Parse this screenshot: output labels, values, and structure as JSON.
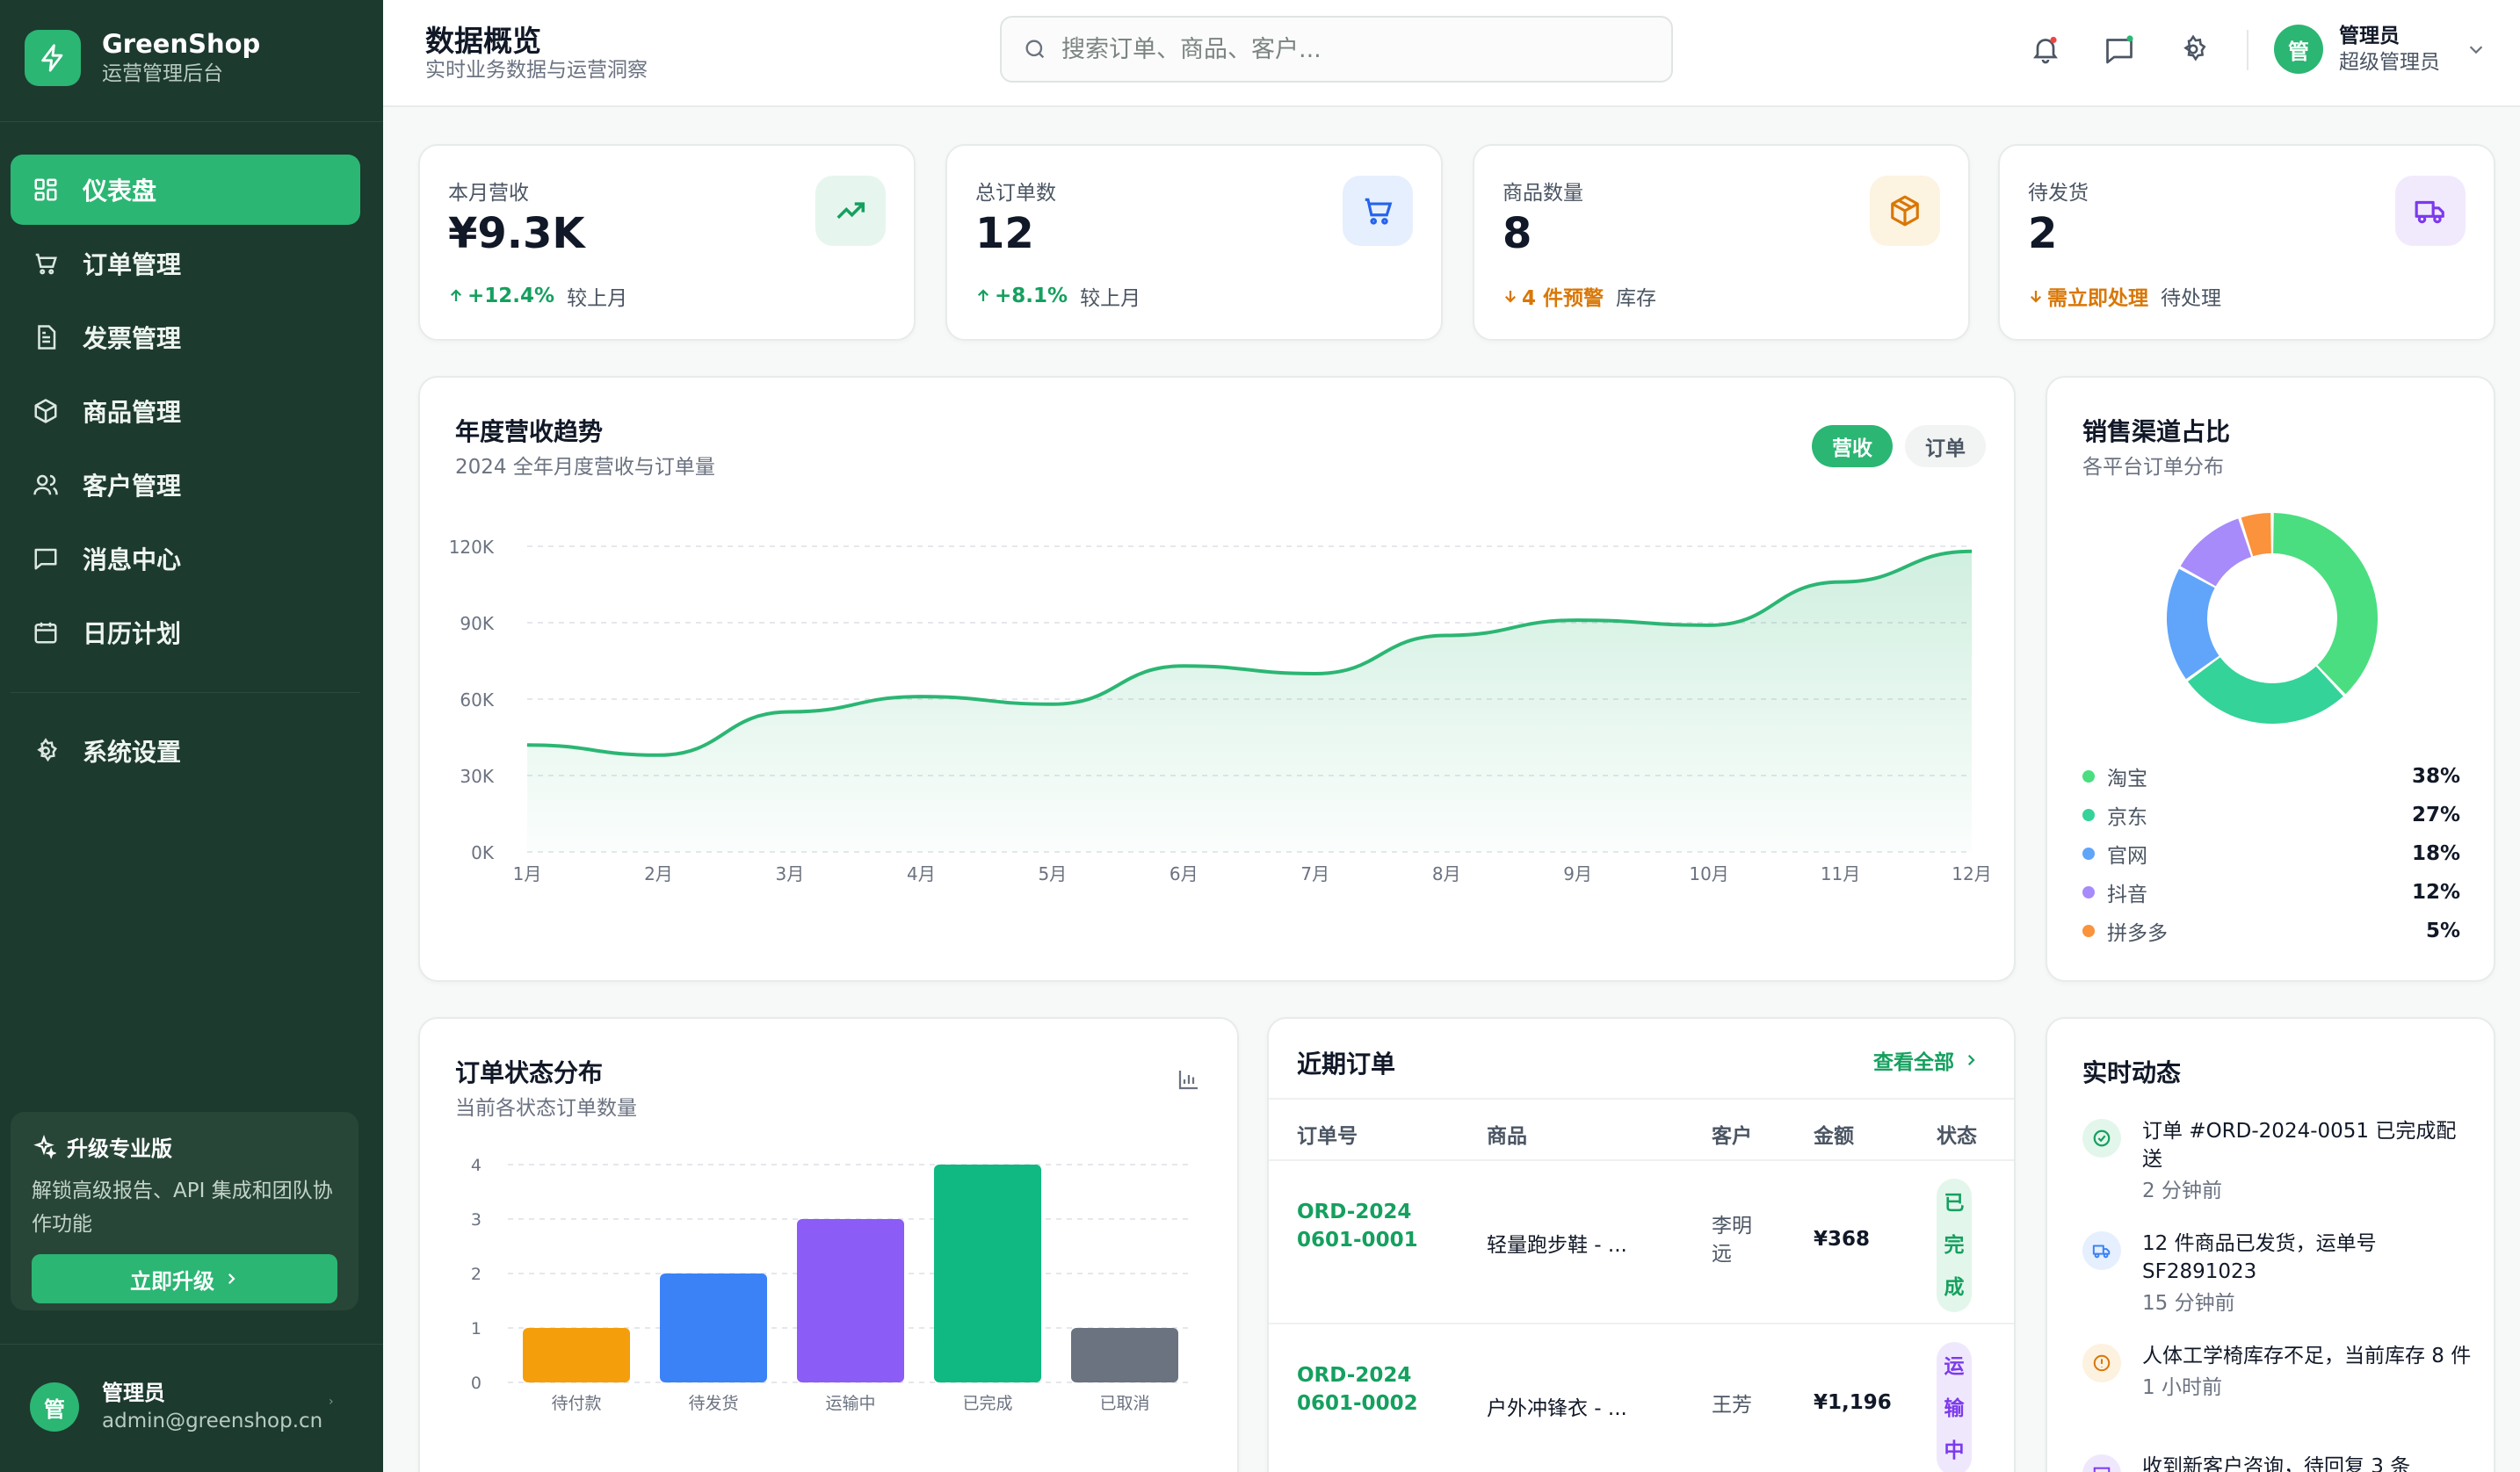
{
  "brand": {
    "name": "GreenShop",
    "subtitle": "运营管理后台"
  },
  "nav": {
    "items": [
      {
        "label": "仪表盘",
        "icon": "dashboard-icon",
        "active": true
      },
      {
        "label": "订单管理",
        "icon": "cart-icon"
      },
      {
        "label": "发票管理",
        "icon": "invoice-icon"
      },
      {
        "label": "商品管理",
        "icon": "box-icon"
      },
      {
        "label": "客户管理",
        "icon": "users-icon"
      },
      {
        "label": "消息中心",
        "icon": "message-icon"
      },
      {
        "label": "日历计划",
        "icon": "calendar-icon"
      }
    ],
    "settings_label": "系统设置"
  },
  "upgrade": {
    "title": "升级专业版",
    "desc": "解锁高级报告、API 集成和团队协作功能",
    "button": "立即升级"
  },
  "side_user": {
    "avatar": "管",
    "name": "管理员",
    "email": "admin@greenshop.cn"
  },
  "header": {
    "title": "数据概览",
    "subtitle": "实时业务数据与运营洞察",
    "search_placeholder": "搜索订单、商品、客户...",
    "user": {
      "avatar": "管",
      "name": "管理员",
      "role": "超级管理员"
    }
  },
  "stats": [
    {
      "label": "本月营收",
      "value": "¥9.3K",
      "trend": "+12.4%",
      "note": "较上月",
      "trend_color": "#15a05f",
      "dir": "up",
      "icon": "trending-up-icon"
    },
    {
      "label": "总订单数",
      "value": "12",
      "trend": "+8.1%",
      "note": "较上月",
      "trend_color": "#15a05f",
      "dir": "up",
      "icon": "cart-icon"
    },
    {
      "label": "商品数量",
      "value": "8",
      "trend": "4 件预警",
      "note": "库存",
      "trend_color": "#d97706",
      "dir": "down",
      "icon": "package-icon"
    },
    {
      "label": "待发货",
      "value": "2",
      "trend": "需立即处理",
      "note": "待处理",
      "trend_color": "#d97706",
      "dir": "down",
      "icon": "truck-icon"
    }
  ],
  "revenue": {
    "title": "年度营收趋势",
    "subtitle": "2024 全年月度营收与订单量",
    "toggle_revenue": "营收",
    "toggle_orders": "订单"
  },
  "channel": {
    "title": "销售渠道占比",
    "subtitle": "各平台订单分布"
  },
  "status_chart": {
    "title": "订单状态分布",
    "subtitle": "当前各状态订单数量"
  },
  "recent": {
    "title": "近期订单",
    "view_all": "查看全部",
    "headers": {
      "order": "订单号",
      "product": "商品",
      "customer": "客户",
      "amount": "金额",
      "status": "状态"
    },
    "rows": [
      {
        "order": "ORD-20240601-0001",
        "product": "轻量跑步鞋 - ...",
        "customer": "李明远",
        "amount": "¥368",
        "status": "已完成",
        "status_color": "#15a05f",
        "status_bg": "#e3f6ec"
      },
      {
        "order": "ORD-20240601-0002",
        "product": "户外冲锋衣 - ...",
        "customer": "王芳",
        "amount": "¥1,196",
        "status": "运输中",
        "status_color": "#7c3aed",
        "status_bg": "#efe8fd"
      }
    ]
  },
  "activity": {
    "title": "实时动态",
    "items": [
      {
        "text": "订单 #ORD-2024-0051 已完成配送",
        "time": "2 分钟前",
        "icon": "check-circle-icon",
        "color": "#15a05f",
        "bg": "#e3f6ec"
      },
      {
        "text": "12 件商品已发货，运单号 SF2891023",
        "time": "15 分钟前",
        "icon": "truck-icon",
        "color": "#3b82f6",
        "bg": "#e6effd"
      },
      {
        "text": "人体工学椅库存不足，当前库存 8 件",
        "time": "1 小时前",
        "icon": "alert-icon",
        "color": "#d97706",
        "bg": "#fdf1e0"
      },
      {
        "text": "收到新客户咨询，待回复 3 条",
        "time": "",
        "icon": "message-icon",
        "color": "#7c3aed",
        "bg": "#efe8fd"
      }
    ]
  },
  "chart_data": [
    {
      "type": "area",
      "title": "年度营收趋势",
      "subtitle": "2024 全年月度营收与订单量",
      "x": [
        "1月",
        "2月",
        "3月",
        "4月",
        "5月",
        "6月",
        "7月",
        "8月",
        "9月",
        "10月",
        "11月",
        "12月"
      ],
      "series": [
        {
          "values": [
            42000,
            38000,
            55000,
            61000,
            58000,
            73000,
            70000,
            85000,
            91000,
            89000,
            106000,
            118000
          ],
          "color": "#2bb673"
        }
      ],
      "y_ticks": [
        "0K",
        "30K",
        "60K",
        "90K",
        "120K"
      ],
      "ylim": [
        0,
        120000
      ],
      "grid": true
    },
    {
      "type": "pie",
      "title": "销售渠道占比",
      "subtitle": "各平台订单分布",
      "donut": true,
      "slices": [
        {
          "name": "淘宝",
          "value": 38,
          "label": "38%",
          "color": "#4ade80"
        },
        {
          "name": "京东",
          "value": 27,
          "label": "27%",
          "color": "#34d399"
        },
        {
          "name": "官网",
          "value": 18,
          "label": "18%",
          "color": "#60a5fa"
        },
        {
          "name": "抖音",
          "value": 12,
          "label": "12%",
          "color": "#a78bfa"
        },
        {
          "name": "拼多多",
          "value": 5,
          "label": "5%",
          "color": "#fb923c"
        }
      ]
    },
    {
      "type": "bar",
      "title": "订单状态分布",
      "subtitle": "当前各状态订单数量",
      "categories": [
        "待付款",
        "待发货",
        "运输中",
        "已完成",
        "已取消"
      ],
      "values": [
        1,
        2,
        3,
        4,
        1
      ],
      "colors": [
        "#f59e0b",
        "#3b82f6",
        "#8b5cf6",
        "#10b981",
        "#6b7280"
      ],
      "y_ticks": [
        "0",
        "1",
        "2",
        "3",
        "4"
      ],
      "ylim": [
        0,
        4
      ],
      "grid": true
    }
  ]
}
